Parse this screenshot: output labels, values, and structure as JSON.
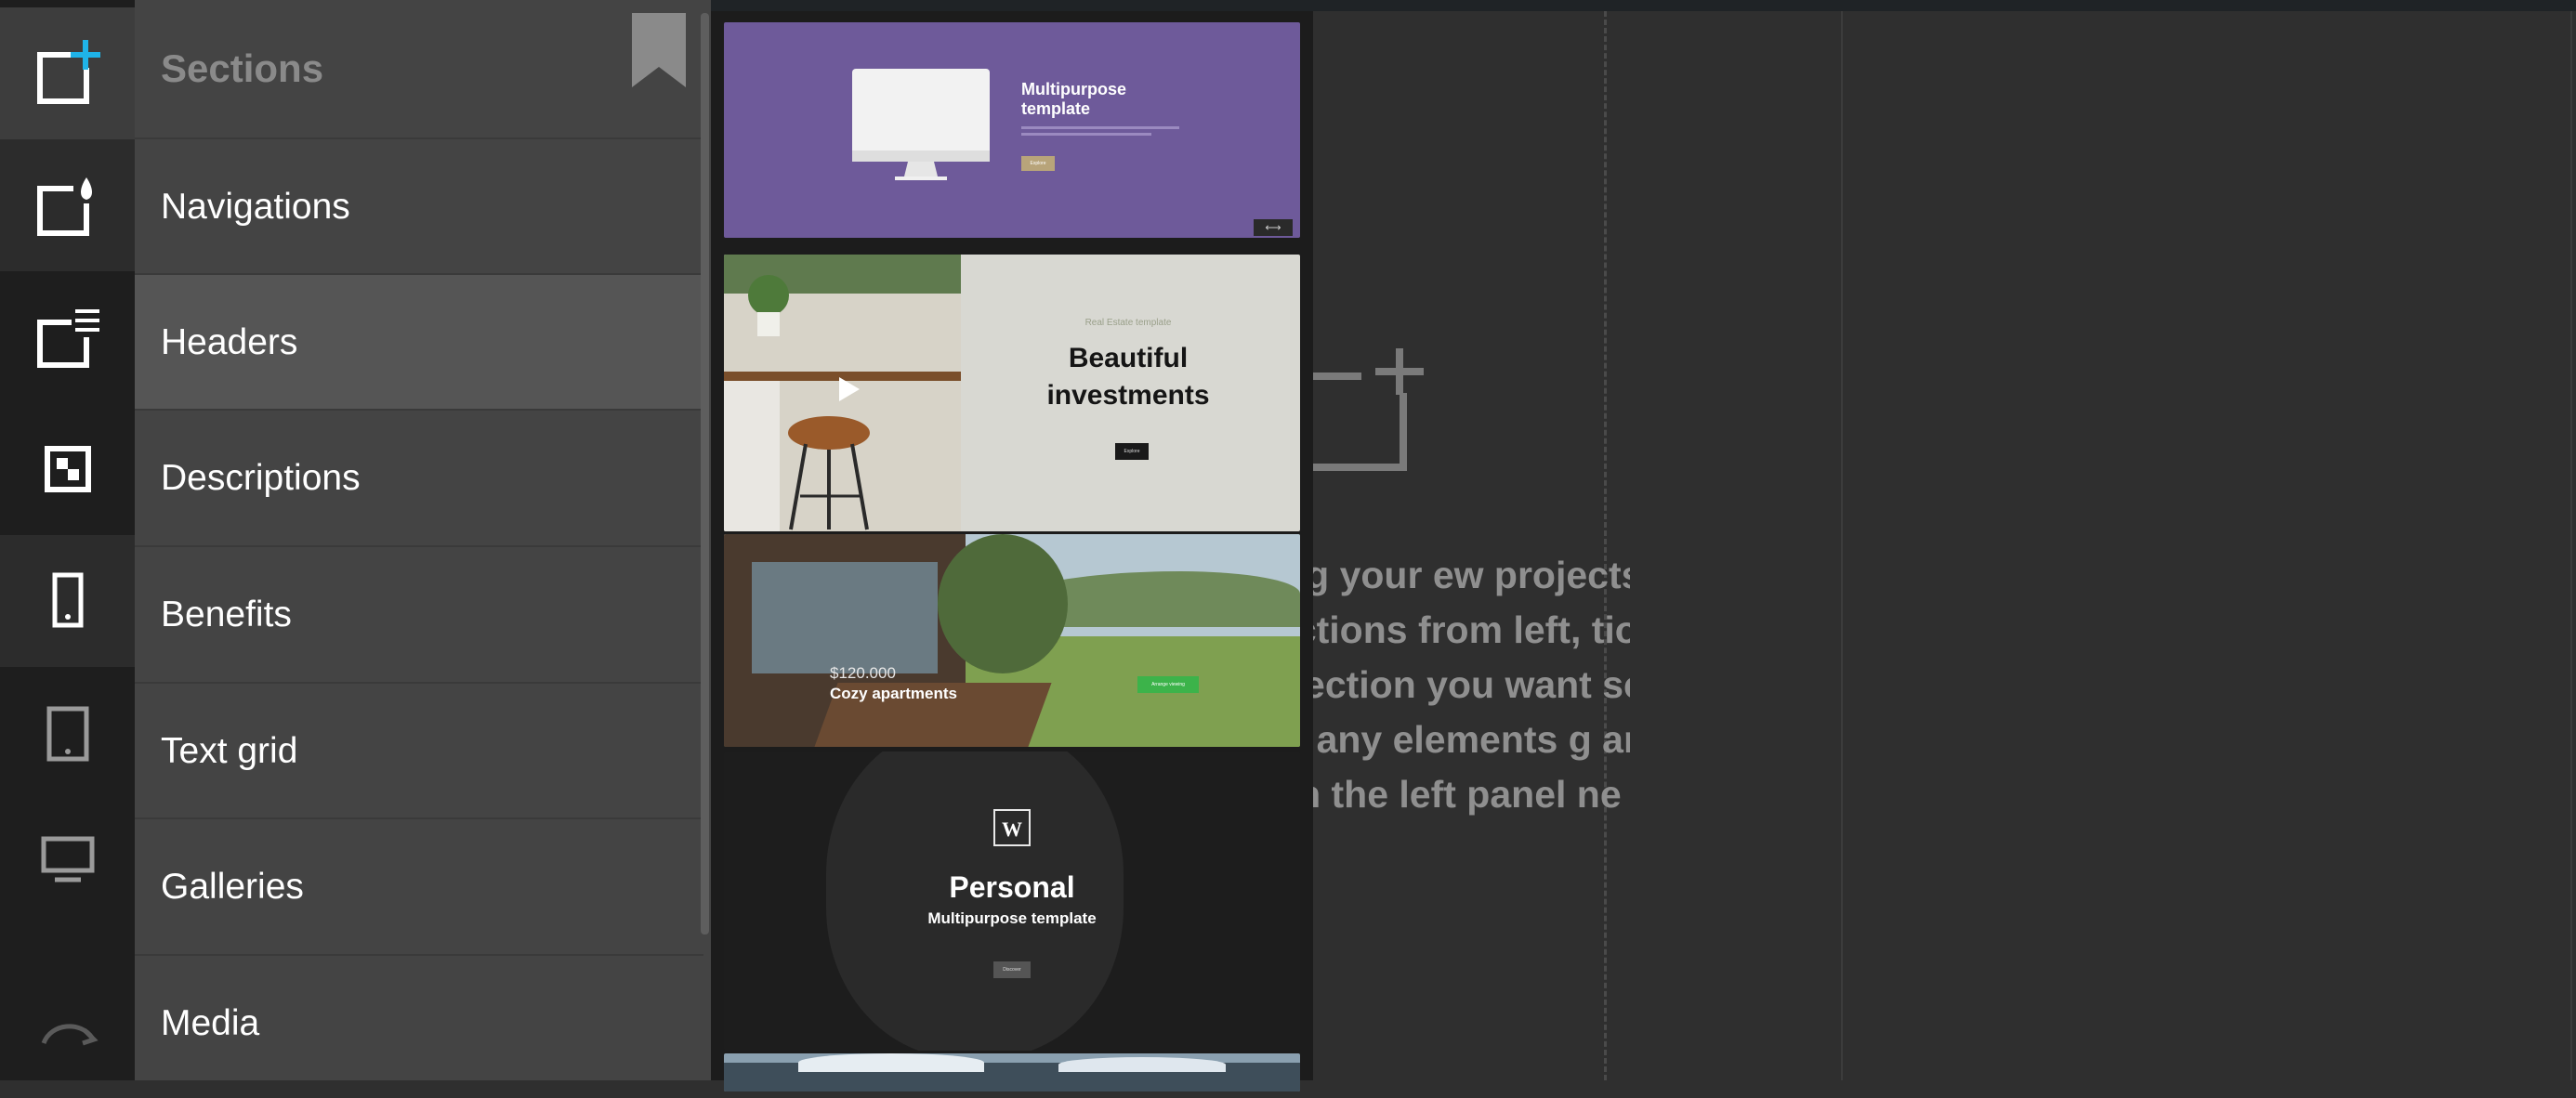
{
  "sidebar": {
    "title": "Sections",
    "items": [
      {
        "label": "Navigations"
      },
      {
        "label": "Headers"
      },
      {
        "label": "Descriptions"
      },
      {
        "label": "Benefits"
      },
      {
        "label": "Text grid"
      },
      {
        "label": "Galleries"
      },
      {
        "label": "Media"
      }
    ]
  },
  "rail": {
    "icons": [
      "add-section-icon",
      "theme-drop-icon",
      "page-list-icon",
      "layers-icon",
      "mobile-view-icon",
      "tablet-view-icon",
      "desktop-view-icon",
      "redo-icon"
    ]
  },
  "templates": [
    {
      "title_line1": "Multipurpose",
      "title_line2": "template",
      "button": "Explore"
    },
    {
      "kicker": "Real Estate template",
      "title_line1": "Beautiful",
      "title_line2": "investments",
      "button": "Explore"
    },
    {
      "price": "$120.000",
      "title": "Cozy apartments",
      "button": "Arrange viewing"
    },
    {
      "logo": "W",
      "title": "Personal",
      "subtitle": "Multipurpose template",
      "button": "Discover"
    }
  ],
  "canvas": {
    "hint_lines": [
      "ew projects",
      "tions from left,",
      "sction you want",
      "g any elements",
      "ne left panel"
    ]
  },
  "colors": {
    "accent": "#1fb3e8",
    "template_purple": "#6e5a9a",
    "cta_green": "#3cb34a"
  }
}
